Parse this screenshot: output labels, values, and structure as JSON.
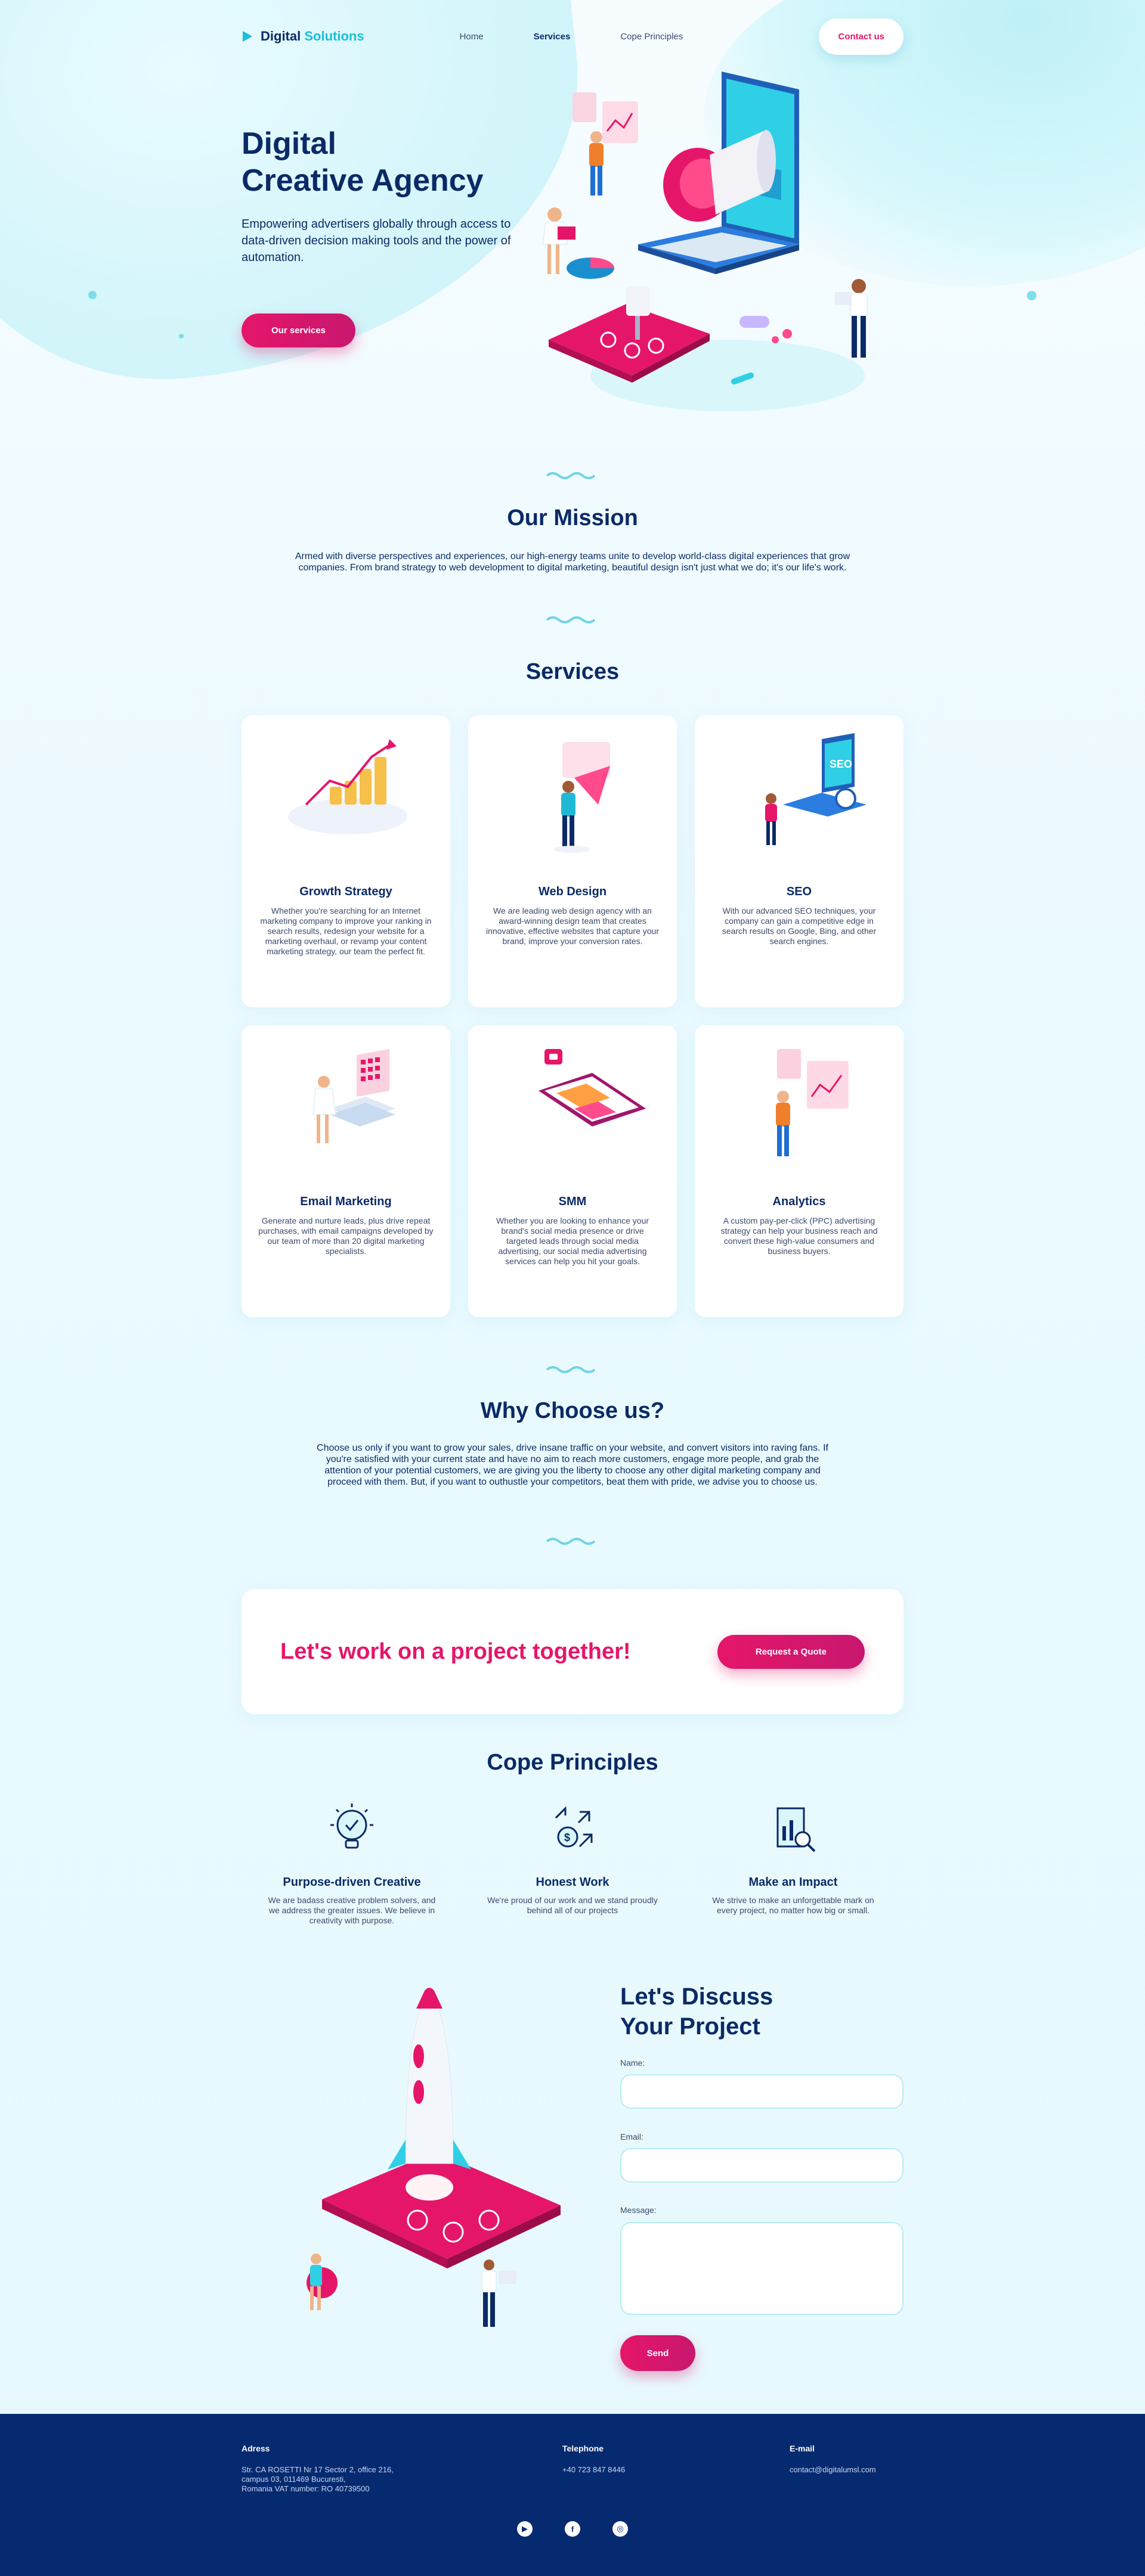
{
  "nav": {
    "logo_main": "Digital",
    "logo_accent": "Solutions",
    "links": [
      "Home",
      "Services",
      "Cope Principles"
    ],
    "active_index": 1,
    "contact_label": "Contact us"
  },
  "hero": {
    "title_line1": "Digital",
    "title_line2": "Creative Agency",
    "subtitle": "Empowering advertisers globally through access to data-driven decision making tools and the power of automation.",
    "cta_label": "Our services"
  },
  "mission": {
    "title": "Our Mission",
    "text": "Armed with diverse perspectives and experiences, our high-energy teams unite to develop world-class digital experiences that grow companies. From brand strategy to web development to digital marketing, beautiful design isn't just what we do; it's our life's work."
  },
  "services": {
    "title": "Services",
    "items": [
      {
        "title": "Growth Strategy",
        "text": "Whether you're searching for an Internet marketing company to improve your ranking in search results, redesign your website for a marketing overhaul, or revamp your content marketing strategy, our team the perfect fit."
      },
      {
        "title": "Web Design",
        "text": "We are leading web design agency with an award-winning design team that creates innovative, effective websites that capture your brand, improve your conversion rates."
      },
      {
        "title": "SEO",
        "text": "With our advanced SEO techniques, your company can gain a competitive edge in search results on Google, Bing, and other search engines."
      },
      {
        "title": "Email Marketing",
        "text": "Generate and nurture leads, plus drive repeat purchases, with email campaigns developed by our team of more than 20 digital marketing specialists."
      },
      {
        "title": "SMM",
        "text": "Whether you are looking to enhance your brand's social media presence or drive targeted leads through social media advertising, our social media advertising services can help you hit your goals."
      },
      {
        "title": "Analytics",
        "text": "A custom pay-per-click (PPC) advertising strategy can help your business reach and convert these high-value consumers and business buyers."
      }
    ]
  },
  "why": {
    "title": "Why Choose us?",
    "text": "Choose us only if you want to grow your sales, drive insane traffic on your website, and convert visitors into raving fans. If you're satisfied with your current state and have no aim to reach more customers, engage more people, and grab the attention of your potential customers, we are giving you the liberty to choose any other digital marketing company and proceed with them. But, if you want to outhustle your competitors, beat them with pride, we advise you to choose us."
  },
  "quote": {
    "text": "Let's work on a project together!",
    "button": "Request a Quote"
  },
  "principles": {
    "title": "Cope Principles",
    "items": [
      {
        "title": "Purpose-driven Creative",
        "text": "We are badass creative problem solvers, and we address the greater issues. We believe in creativity with purpose.",
        "icon": "lightbulb-icon"
      },
      {
        "title": "Honest Work",
        "text": "We're proud of our work and we stand proudly behind all of our projects",
        "icon": "dollar-arrows-icon"
      },
      {
        "title": "Make an Impact",
        "text": "We strive to make an unforgettable mark on every project, no matter how big or small.",
        "icon": "report-search-icon"
      }
    ]
  },
  "contact": {
    "title_line1": "Let's Discuss",
    "title_line2": "Your Project",
    "name_label": "Name:",
    "email_label": "Email:",
    "message_label": "Message:",
    "send_label": "Send"
  },
  "footer": {
    "address_heading": "Adress",
    "address_lines": [
      "Str. CA ROSETTI Nr 17 Sector 2, office 216,",
      "campus 03, 011469 Bucuresti,",
      "Romania VAT number: RO 40739500"
    ],
    "phone_heading": "Telephone",
    "phone": "+40 723 847 8446",
    "email_heading": "E-mail",
    "email": "contact@digitalumsl.com",
    "socials": [
      "youtube-icon",
      "facebook-icon",
      "instagram-icon"
    ]
  },
  "colors": {
    "navy": "#0b2a66",
    "pink": "#e5166a",
    "cyan": "#18c0d8",
    "footer": "#062a6f"
  }
}
